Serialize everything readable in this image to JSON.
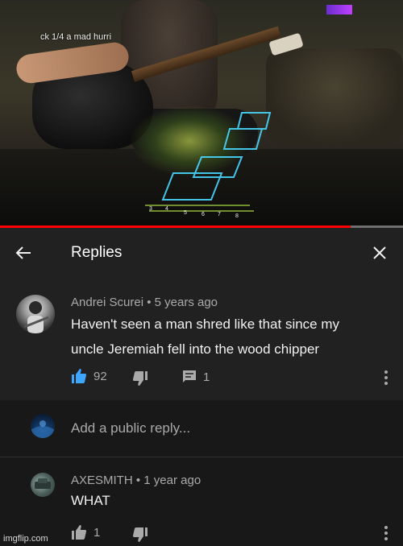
{
  "video": {
    "hud_text": "ck 1/4 a mad hurri",
    "progress_fraction": 0.87
  },
  "header": {
    "title": "Replies",
    "back_icon": "arrow-left-icon",
    "close_icon": "close-icon"
  },
  "main_comment": {
    "author": "Andrei Scurei",
    "time": "5 years ago",
    "text_line1": "Haven't seen a man shred like that since my",
    "text_line2": "uncle Jeremiah fell into the wood chipper",
    "likes": "92",
    "replies": "1",
    "like_active_color": "#3ea6ff"
  },
  "add_reply": {
    "placeholder": "Add a public reply..."
  },
  "reply": {
    "author": "AXESMITH",
    "time": "1 year ago",
    "text": "WHAT",
    "likes": "1"
  },
  "watermark": "imgflip.com",
  "colors": {
    "panel": "#212121",
    "background": "#181818",
    "muted_text": "#aaaaaa",
    "progress": "#ff0000"
  }
}
